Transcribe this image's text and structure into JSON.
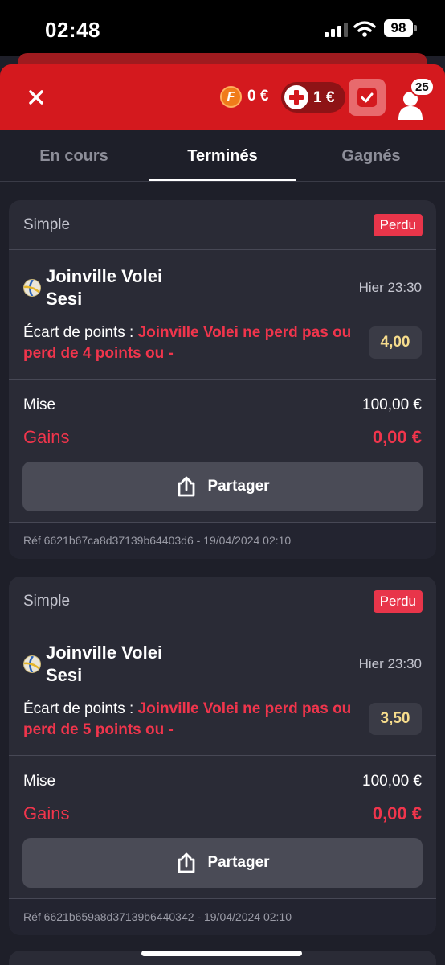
{
  "status_bar": {
    "time": "02:48",
    "battery": "98"
  },
  "header": {
    "close_icon": "close-icon",
    "freebet_icon_letter": "F",
    "freebet_balance": "0 €",
    "bonus_balance": "1 €",
    "profile_badge": "25",
    "accent_color": "#d4191e"
  },
  "tabs": [
    {
      "label": "En cours",
      "active": false
    },
    {
      "label": "Terminés",
      "active": true
    },
    {
      "label": "Gagnés",
      "active": false
    }
  ],
  "bets": [
    {
      "type": "Simple",
      "status": "Perdu",
      "team1": "Joinville Volei",
      "team2": "Sesi",
      "time": "Hier 23:30",
      "market_label": "Écart de points : ",
      "selection": "Joinville Volei ne perd pas ou perd de 4 points ou -",
      "odds": "4,00",
      "stake_label": "Mise",
      "stake": "100,00 €",
      "gains_label": "Gains",
      "gains": "0,00 €",
      "share_label": "Partager",
      "ref": "Réf 6621b67ca8d37139b64403d6 - 19/04/2024 02:10"
    },
    {
      "type": "Simple",
      "status": "Perdu",
      "team1": "Joinville Volei",
      "team2": "Sesi",
      "time": "Hier 23:30",
      "market_label": "Écart de points : ",
      "selection": "Joinville Volei ne perd pas ou perd de 5 points ou -",
      "odds": "3,50",
      "stake_label": "Mise",
      "stake": "100,00 €",
      "gains_label": "Gains",
      "gains": "0,00 €",
      "share_label": "Partager",
      "ref": "Réf 6621b659a8d37139b6440342 - 19/04/2024 02:10"
    }
  ]
}
